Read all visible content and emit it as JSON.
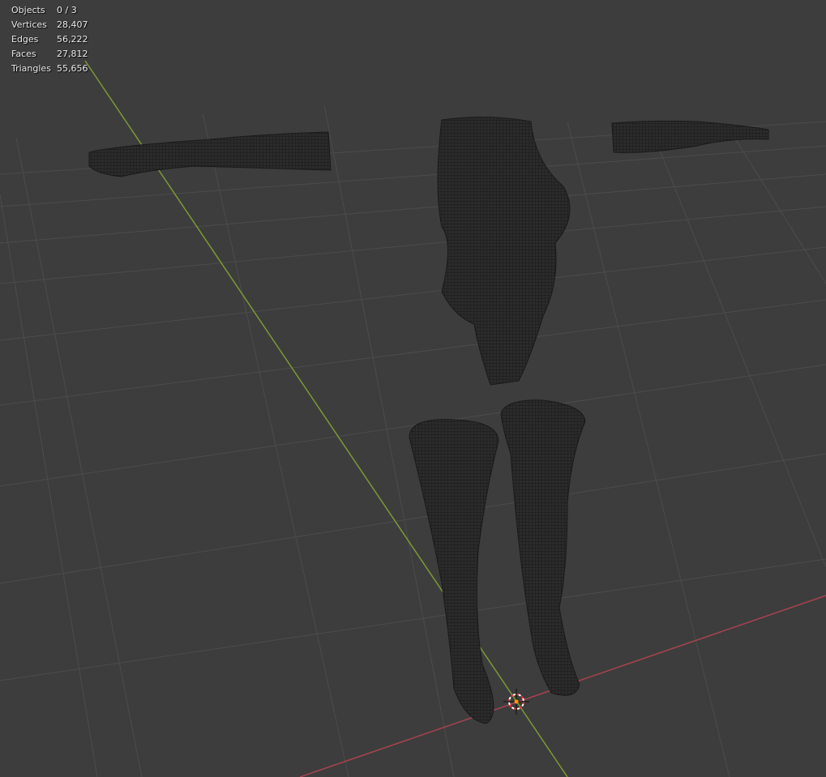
{
  "stats": [
    {
      "label": "Objects",
      "value": "0 / 3"
    },
    {
      "label": "Vertices",
      "value": "28,407"
    },
    {
      "label": "Edges",
      "value": "56,222"
    },
    {
      "label": "Faces",
      "value": "27,812"
    },
    {
      "label": "Triangles",
      "value": "55,656"
    }
  ],
  "colors": {
    "background": "#3d3d3d",
    "grid": "#4f4f4f",
    "y_axis": "#7a9a35",
    "x_axis": "#a8434f",
    "mesh": "#262626"
  }
}
